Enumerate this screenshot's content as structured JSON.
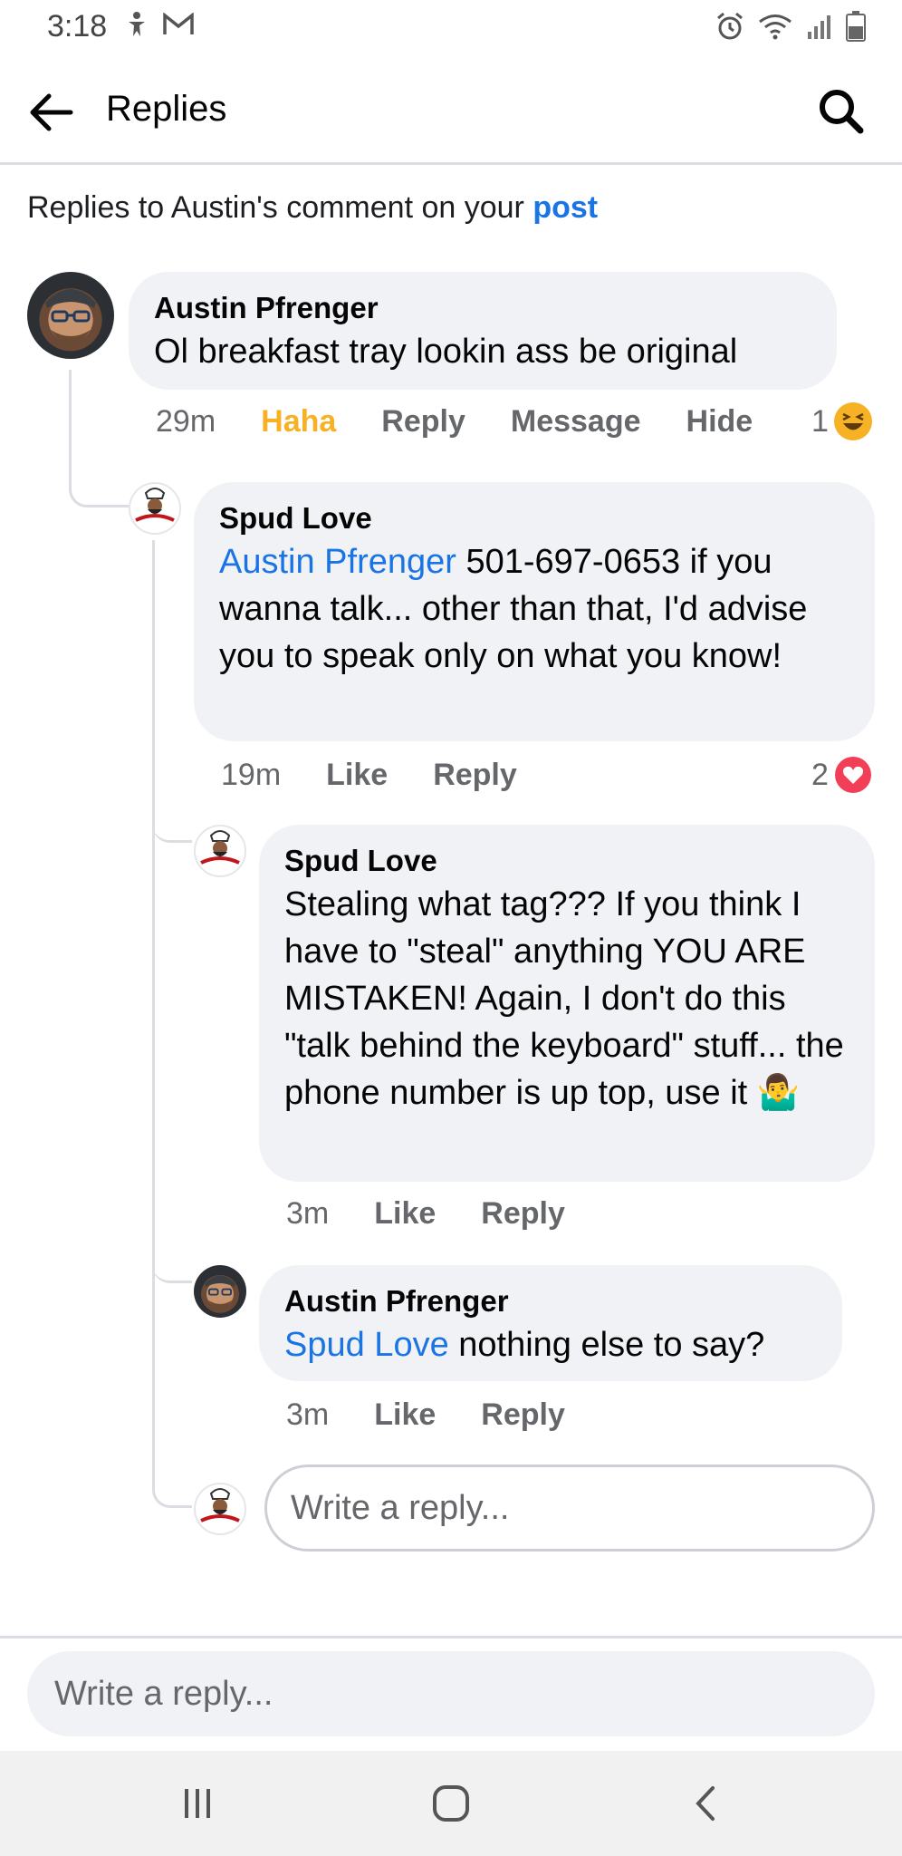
{
  "status_bar": {
    "time": "3:18",
    "left_icons": [
      "accessibility-icon",
      "gmail-icon"
    ],
    "right_icons": [
      "alarm-icon",
      "wifi-icon",
      "signal-icon",
      "battery-icon"
    ]
  },
  "header": {
    "title": "Replies",
    "back_icon": "back-arrow-icon",
    "search_icon": "search-icon"
  },
  "context": {
    "prefix": "Replies to Austin's comment on your ",
    "link": "post"
  },
  "comments": [
    {
      "author": "Austin Pfrenger",
      "text": "Ol breakfast tray lookin ass be original",
      "time": "29m",
      "actions": [
        "Haha",
        "Reply",
        "Message",
        "Hide"
      ],
      "reaction_count": "1",
      "reaction_type": "haha"
    },
    {
      "author": "Spud Love",
      "mention": "Austin Pfrenger",
      "text": " 501-697-0653 if you wanna talk... other than that, I'd advise you to speak only on what you know!",
      "time": "19m",
      "actions": [
        "Like",
        "Reply"
      ],
      "reaction_count": "2",
      "reaction_type": "love"
    },
    {
      "author": "Spud Love",
      "text": "Stealing what tag??? If you think I have to \"steal\" anything YOU ARE MISTAKEN! Again, I don't do this \"talk behind the keyboard\" stuff... the phone number is up top, use it ",
      "emoji": "🤷‍♂️",
      "time": "3m",
      "actions": [
        "Like",
        "Reply"
      ]
    },
    {
      "author": "Austin Pfrenger",
      "mention": "Spud Love",
      "text": " nothing else to say?",
      "time": "3m",
      "actions": [
        "Like",
        "Reply"
      ]
    }
  ],
  "inline_reply": {
    "placeholder": "Write a reply..."
  },
  "composer": {
    "placeholder": "Write a reply..."
  },
  "nav_bar": {
    "icons": [
      "recent-apps-icon",
      "home-icon",
      "nav-back-icon"
    ]
  },
  "colors": {
    "link": "#1b74e4",
    "haha": "#f7b125",
    "love": "#f33e58",
    "bubble": "#f0f2f5"
  }
}
